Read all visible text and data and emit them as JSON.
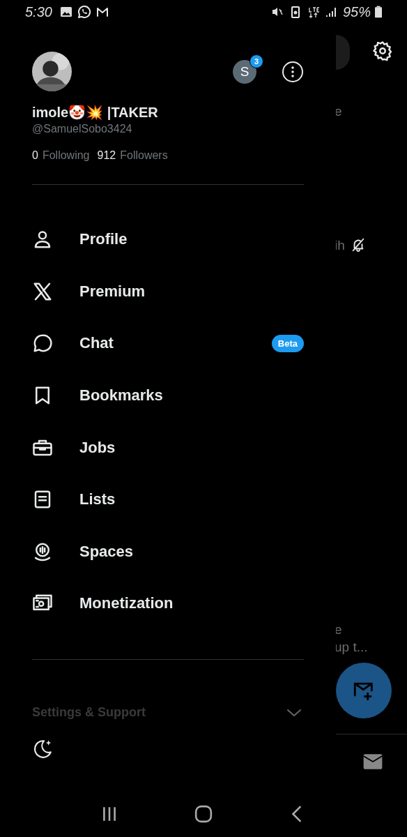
{
  "status_bar": {
    "time": "5:30",
    "battery": "95%"
  },
  "background": {
    "fragments": [
      {
        "text": "e"
      },
      {
        "text": "ih"
      },
      {
        "text": "e"
      },
      {
        "text": "up t..."
      }
    ]
  },
  "account": {
    "switch_letter": "S",
    "switch_badge": "3",
    "display_name": "imole🤡💥 |TAKER",
    "handle": "@SamuelSobo3424",
    "following_count": "0",
    "following_label": "Following",
    "followers_count": "912",
    "followers_label": "Followers"
  },
  "menu": [
    {
      "kind": "person",
      "label": "Profile"
    },
    {
      "kind": "x",
      "label": "Premium"
    },
    {
      "kind": "chat",
      "label": "Chat",
      "badge": "Beta"
    },
    {
      "kind": "bookmark",
      "label": "Bookmarks"
    },
    {
      "kind": "briefcase",
      "label": "Jobs"
    },
    {
      "kind": "list",
      "label": "Lists"
    },
    {
      "kind": "spaces",
      "label": "Spaces"
    },
    {
      "kind": "money",
      "label": "Monetization"
    }
  ],
  "settings_section": {
    "label": "Settings & Support",
    "expanded": false
  }
}
